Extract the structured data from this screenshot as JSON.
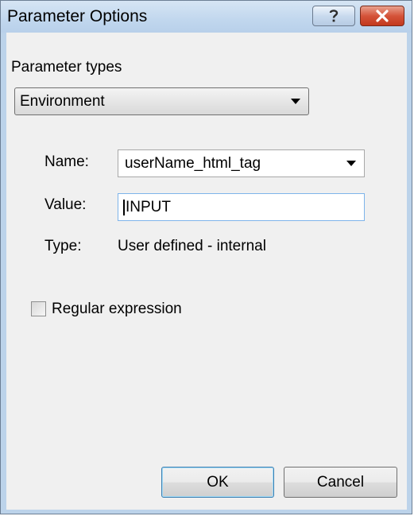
{
  "window": {
    "title": "Parameter Options",
    "help_icon": "question-mark-icon",
    "close_icon": "close-x-icon",
    "close_color": "#c2381d"
  },
  "parameter_types": {
    "label": "Parameter types",
    "selected": "Environment"
  },
  "fields": {
    "name_label": "Name:",
    "name_value": "userName_html_tag",
    "value_label": "Value:",
    "value_value": "INPUT",
    "type_label": "Type:",
    "type_value": "User defined - internal"
  },
  "regex": {
    "label": "Regular expression",
    "checked": false
  },
  "buttons": {
    "ok": "OK",
    "cancel": "Cancel"
  }
}
